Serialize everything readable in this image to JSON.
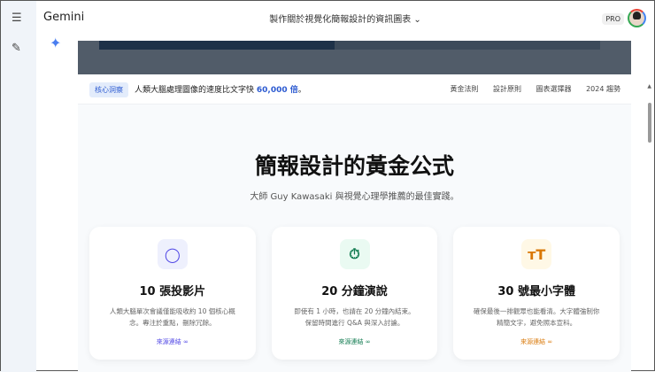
{
  "app": {
    "brand": "Gemini",
    "title": "製作關於視覺化簡報設計的資訊圖表",
    "pro": "PRO"
  },
  "nav": {
    "tag": "核心洞察",
    "insight_pre": "人類大腦處理圖像的速度比文字快",
    "insight_num": "60,000 倍",
    "insight_post": "。",
    "links": [
      "黃金法則",
      "設計原則",
      "圖表選擇器",
      "2024 趨勢"
    ]
  },
  "main": {
    "title": "簡報設計的黃金公式",
    "subtitle": "大師 Guy Kawasaki 與視覺心理學推薦的最佳實踐。"
  },
  "cards": [
    {
      "title": "10 張投影片",
      "desc": "人類大腦單次會議僅能吸收約 10 個核心概念。專注於重點，刪除冗餘。",
      "link": "來源連結",
      "color": "#4f46e5",
      "bg": "#eef0fd"
    },
    {
      "title": "20 分鐘演說",
      "desc": "即使有 1 小時，也請在 20 分鐘內結束。保留時間進行 Q&A 與深入討論。",
      "link": "來源連結",
      "color": "#0f7a4f",
      "bg": "#eafaf2"
    },
    {
      "title": "30 號最小字體",
      "desc": "確保最後一排觀眾也能看清。大字體強制你精簡文字，避免照本宣科。",
      "link": "來源連結",
      "color": "#d97706",
      "bg": "#fff8e6"
    }
  ]
}
